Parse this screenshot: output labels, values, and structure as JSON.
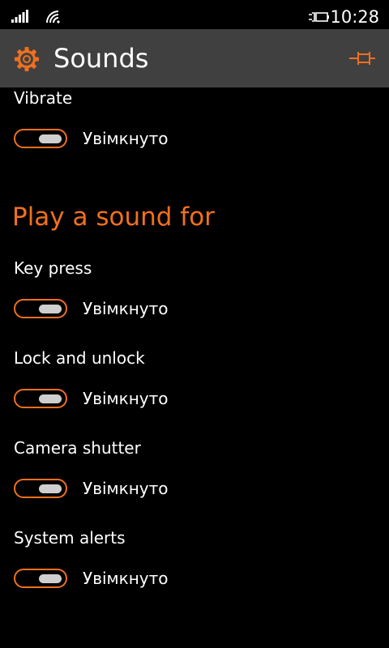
{
  "status_bar": {
    "time": "10:28",
    "icons": [
      "signal-icon",
      "wifi-icon",
      "battery-charging-icon"
    ]
  },
  "header": {
    "title": "Sounds",
    "icons": [
      "gear-icon",
      "pin-icon"
    ]
  },
  "colors": {
    "accent": "#f0701e",
    "header_bg": "#404040",
    "background": "#000000",
    "text": "#ffffff",
    "toggle_knob": "#cfcfcf"
  },
  "vibrate": {
    "label": "Vibrate",
    "state": "Увімкнуто",
    "on": true
  },
  "section": {
    "title": "Play a sound for"
  },
  "sound_items": [
    {
      "label": "Key press",
      "state": "Увімкнуто",
      "on": true
    },
    {
      "label": "Lock and unlock",
      "state": "Увімкнуто",
      "on": true
    },
    {
      "label": "Camera shutter",
      "state": "Увімкнуто",
      "on": true
    },
    {
      "label": "System alerts",
      "state": "Увімкнуто",
      "on": true
    }
  ]
}
